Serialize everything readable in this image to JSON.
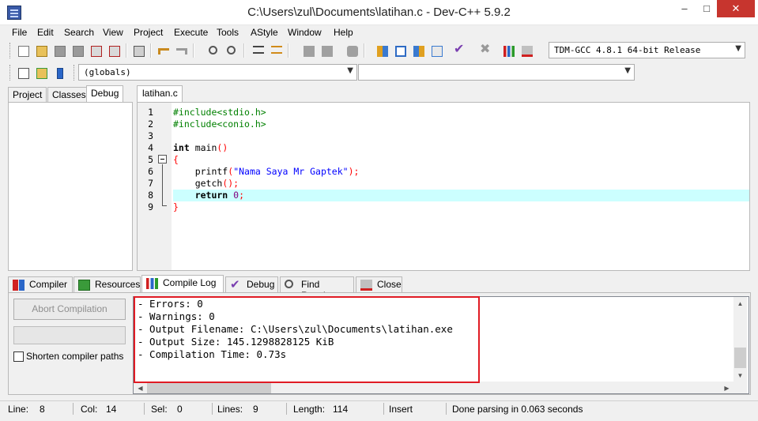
{
  "window": {
    "title": "C:\\Users\\zul\\Documents\\latihan.c - Dev-C++ 5.9.2",
    "minimize": "–",
    "maximize": "□",
    "close": "✕"
  },
  "menu": [
    "File",
    "Edit",
    "Search",
    "View",
    "Project",
    "Execute",
    "Tools",
    "AStyle",
    "Window",
    "Help"
  ],
  "toolbar": {
    "compiler_select": "TDM-GCC 4.8.1 64-bit Release",
    "globals_select": "(globals)",
    "function_select": ""
  },
  "left_panel": {
    "tabs": [
      "Project",
      "Classes",
      "Debug"
    ],
    "active_tab": "Debug"
  },
  "editor": {
    "tab": "latihan.c",
    "line_numbers": [
      "1",
      "2",
      "3",
      "4",
      "5",
      "6",
      "7",
      "8",
      "9"
    ],
    "code": {
      "l1": "#include<stdio.h>",
      "l2": "#include<conio.h>",
      "l4_kw": "int",
      "l4_rest": " main",
      "l4_paren": "()",
      "l5": "{",
      "l6_fn": "    printf",
      "l6_open": "(",
      "l6_str": "\"Nama Saya Mr Gaptek\"",
      "l6_close": ");",
      "l7_fn": "    getch",
      "l7_paren": "();",
      "l8_kw": "    return",
      "l8_num": " 0",
      "l8_semi": ";",
      "l9": "}"
    }
  },
  "bottom_tabs": [
    "Compiler",
    "Resources",
    "Compile Log",
    "Debug",
    "Find Results",
    "Close"
  ],
  "bottom_active_tab": "Compile Log",
  "compile_panel": {
    "abort_button": "Abort Compilation",
    "progress": 0,
    "shorten_paths_label": "Shorten compiler paths",
    "shorten_paths_checked": false,
    "log": [
      "- Errors: 0",
      "- Warnings: 0",
      "- Output Filename: C:\\Users\\zul\\Documents\\latihan.exe",
      "- Output Size: 145.1298828125 KiB",
      "- Compilation Time: 0.73s"
    ]
  },
  "statusbar": {
    "line_label": "Line:",
    "line_value": "8",
    "col_label": "Col:",
    "col_value": "14",
    "sel_label": "Sel:",
    "sel_value": "0",
    "lines_label": "Lines:",
    "lines_value": "9",
    "length_label": "Length:",
    "length_value": "114",
    "mode": "Insert",
    "message": "Done parsing in 0.063 seconds"
  },
  "colors": {
    "highlight_line": "#ccffff",
    "close_button": "#c7352e",
    "annotation_box": "#e01b24"
  }
}
